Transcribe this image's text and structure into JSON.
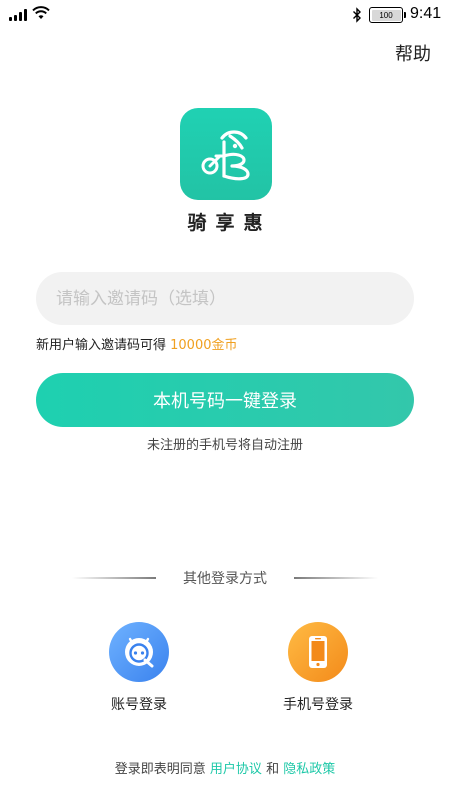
{
  "status_bar": {
    "battery_level": "100",
    "time": "9:41"
  },
  "header": {
    "help_label": "帮助"
  },
  "app": {
    "name": "骑享惠",
    "brand_color": "#22c9ab"
  },
  "invite": {
    "placeholder": "请输入邀请码（选填）",
    "value": "",
    "tip_prefix": "新用户输入邀请码可得 ",
    "tip_reward": "10000金币",
    "reward_color": "#f0a020"
  },
  "login": {
    "one_tap_label": "本机号码一键登录",
    "auto_register_note": "未注册的手机号将自动注册"
  },
  "other_methods": {
    "title": "其他登录方式",
    "items": [
      {
        "label": "账号登录",
        "icon": "account-login-icon",
        "color": "#4a90f0"
      },
      {
        "label": "手机号登录",
        "icon": "phone-icon",
        "color": "#f7a030"
      }
    ]
  },
  "agreement": {
    "prefix": "登录即表明同意 ",
    "user_agreement": "用户协议",
    "conjunction": " 和 ",
    "privacy_policy": "隐私政策",
    "link_color": "#1ec8a8"
  }
}
